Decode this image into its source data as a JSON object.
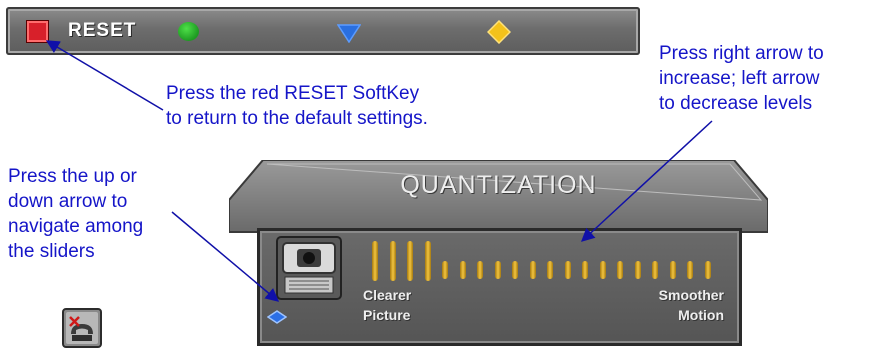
{
  "softkey_bar": {
    "reset_label": "RESET",
    "keys": [
      {
        "icon": "red-square-icon",
        "color": "#d8202a"
      },
      {
        "icon": "green-circle-icon",
        "color": "#2bb531"
      },
      {
        "icon": "blue-triangle-icon",
        "color": "#2a6fe0"
      },
      {
        "icon": "yellow-diamond-icon",
        "color": "#f3c21b"
      }
    ]
  },
  "annotations": {
    "reset_line1": "Press the red RESET SoftKey",
    "reset_line2": "to return to the default settings.",
    "right_line1": "Press right arrow to",
    "right_line2": "increase; left arrow",
    "right_line3": "to decrease levels",
    "nav_line1": "Press the up or",
    "nav_line2": "down arrow to",
    "nav_line3": "navigate among",
    "nav_line4": "the sliders"
  },
  "quantization": {
    "title": "QUANTIZATION",
    "left_label_line1": "Clearer",
    "left_label_line2": "Picture",
    "right_label_line1": "Smoother",
    "right_label_line2": "Motion",
    "slider_steps": 20,
    "slider_level": 4,
    "icon": "camera-icon"
  },
  "footer_icon": "phone-hangup-icon",
  "annotation_color": "#1515c8"
}
